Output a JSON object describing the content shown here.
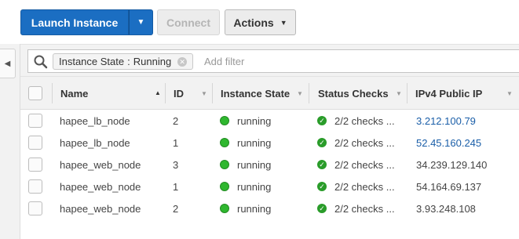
{
  "toolbar": {
    "launch_label": "Launch Instance",
    "connect_label": "Connect",
    "actions_label": "Actions"
  },
  "filter": {
    "token_key": "Instance State",
    "token_sep": ":",
    "token_value": "Running",
    "placeholder": "Add filter"
  },
  "columns": {
    "name": "Name",
    "id": "ID",
    "state": "Instance State",
    "checks": "Status Checks",
    "ip": "IPv4 Public IP"
  },
  "rows": [
    {
      "name": "hapee_lb_node",
      "id": "2",
      "state": "running",
      "checks": "2/2 checks ...",
      "ip": "3.212.100.79",
      "ip_linked": true
    },
    {
      "name": "hapee_lb_node",
      "id": "1",
      "state": "running",
      "checks": "2/2 checks ...",
      "ip": "52.45.160.245",
      "ip_linked": true
    },
    {
      "name": "hapee_web_node",
      "id": "3",
      "state": "running",
      "checks": "2/2 checks ...",
      "ip": "34.239.129.140",
      "ip_linked": false
    },
    {
      "name": "hapee_web_node",
      "id": "1",
      "state": "running",
      "checks": "2/2 checks ...",
      "ip": "54.164.69.137",
      "ip_linked": false
    },
    {
      "name": "hapee_web_node",
      "id": "2",
      "state": "running",
      "checks": "2/2 checks ...",
      "ip": "3.93.248.108",
      "ip_linked": false
    }
  ],
  "colors": {
    "primary": "#1b6ec2",
    "running": "#2fb72f",
    "link": "#1a5ea8"
  }
}
